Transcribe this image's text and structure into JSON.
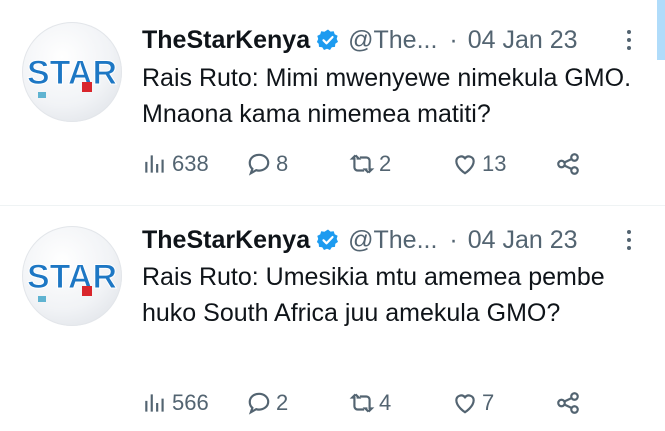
{
  "brand": {
    "verified_color": "#1d9bf0",
    "avatar_text": "STAR"
  },
  "tweets": [
    {
      "name": "TheStarKenya",
      "handle": "@The...",
      "separator": "·",
      "date": "04 Jan 23",
      "text": "Rais Ruto: Mimi mwenyewe nimekula GMO. Mnaona kama nimemea matiti?",
      "views": "638",
      "replies": "8",
      "retweets": "2",
      "likes": "13"
    },
    {
      "name": "TheStarKenya",
      "handle": "@The...",
      "separator": "·",
      "date": "04 Jan 23",
      "text": "Rais Ruto: Umesikia mtu amemea pembe huko South Africa juu amekula GMO?",
      "views": "566",
      "replies": "2",
      "retweets": "4",
      "likes": "7"
    }
  ]
}
